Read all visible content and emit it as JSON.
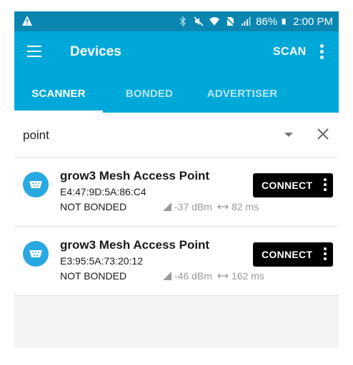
{
  "status_bar": {
    "battery": "86%",
    "time": "2:00 PM"
  },
  "app_bar": {
    "title": "Devices",
    "scan_label": "SCAN"
  },
  "tabs": [
    {
      "label": "SCANNER",
      "active": true
    },
    {
      "label": "BONDED",
      "active": false
    },
    {
      "label": "ADVERTISER",
      "active": false
    }
  ],
  "filter": {
    "value": "point"
  },
  "devices": [
    {
      "name": "grow3 Mesh Access Point",
      "address": "E4:47:9D:5A:86:C4",
      "bond_state": "NOT BONDED",
      "rssi": "-37 dBm",
      "interval": "82 ms",
      "connect_label": "CONNECT"
    },
    {
      "name": "grow3 Mesh Access Point",
      "address": "E3:95:5A:73:20:12",
      "bond_state": "NOT BONDED",
      "rssi": "-46 dBm",
      "interval": "162 ms",
      "connect_label": "CONNECT"
    }
  ],
  "colors": {
    "status_bar": "#0a86b1",
    "app_bar": "#00a8d9",
    "device_icon": "#29a9e1",
    "connect_button": "#000000"
  },
  "icons": {
    "status_left": "warning-icon",
    "status_right": [
      "bluetooth-icon",
      "mute-icon",
      "wifi-icon",
      "no-sim-icon",
      "signal-icon",
      "battery-icon"
    ],
    "device": "serial-port-icon",
    "rssi": "signal-strength-icon",
    "interval": "interval-arrows-icon"
  }
}
